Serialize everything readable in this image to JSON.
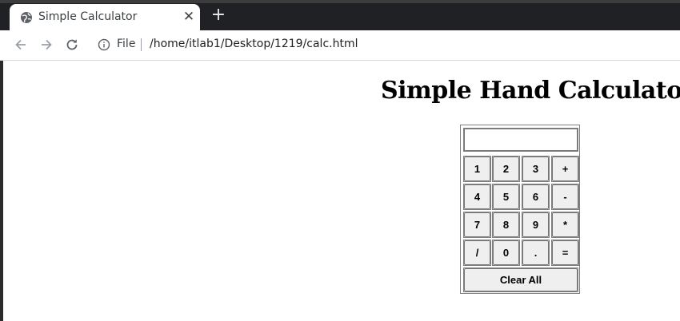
{
  "browser": {
    "tab_title": "Simple Calculator",
    "tab_close": "✕",
    "new_tab": "+",
    "address_scheme": "File",
    "address_url": "/home/itlab1/Desktop/1219/calc.html"
  },
  "page": {
    "title": "Simple Hand Calculator"
  },
  "calculator": {
    "display_value": "",
    "rows": [
      [
        "1",
        "2",
        "3",
        "+"
      ],
      [
        "4",
        "5",
        "6",
        "-"
      ],
      [
        "7",
        "8",
        "9",
        "*"
      ],
      [
        "/",
        "0",
        ".",
        "="
      ]
    ],
    "clear_label": "Clear All"
  },
  "colors": {
    "tabbar_bg": "#202124",
    "button_bg": "#efefef",
    "border": "#808080"
  }
}
